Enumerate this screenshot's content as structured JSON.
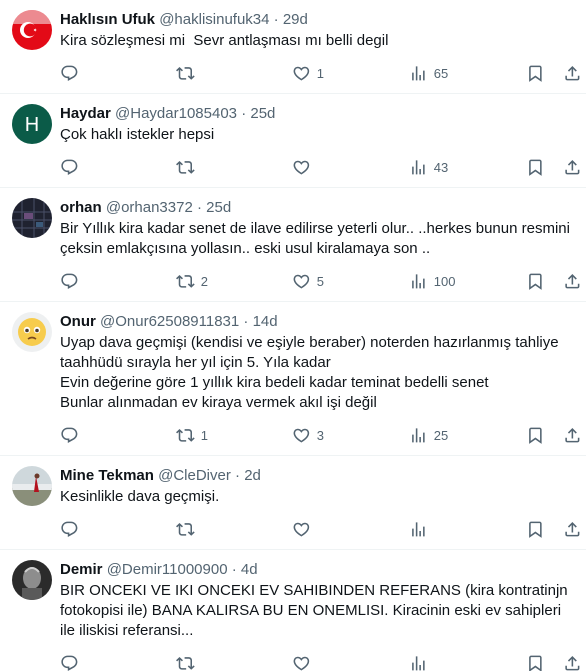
{
  "tweets": [
    {
      "name": "Haklısın Ufuk",
      "handle": "@haklisinufuk34",
      "time": "29d",
      "text": "Kira sözleşmesi mi  Sevr antlaşması mı belli degil",
      "replies": "",
      "retweets": "",
      "likes": "1",
      "views": "65",
      "avatar": "turkish-flag"
    },
    {
      "name": "Haydar",
      "handle": "@Haydar1085403",
      "time": "25d",
      "text": "Çok haklı istekler hepsi",
      "replies": "",
      "retweets": "",
      "likes": "",
      "views": "43",
      "avatar_letter": "H",
      "avatar_color": "#0b5b48"
    },
    {
      "name": "orhan",
      "handle": "@orhan3372",
      "time": "25d",
      "text": "Bir Yıllık kira kadar senet de ilave edilirse yeterli olur.. ..herkes bunun resmini çeksin emlakçısına yollasın.. eski usul kiralamaya son ..",
      "replies": "",
      "retweets": "2",
      "likes": "5",
      "views": "100",
      "avatar": "dark-pattern"
    },
    {
      "name": "Onur",
      "handle": "@Onur62508911831",
      "time": "14d",
      "text": "Uyap dava geçmişi (kendisi ve eşiyle beraber) noterden hazırlanmış tahliye taahhüdü sırayla her yıl için 5. Yıla kadar\nEvin değerine göre 1 yıllık kira bedeli kadar teminat bedelli senet\nBunlar alınmadan ev kiraya vermek akıl işi değil",
      "replies": "",
      "retweets": "1",
      "likes": "3",
      "views": "25",
      "avatar": "emoji-face"
    },
    {
      "name": "Mine Tekman",
      "handle": "@CleDiver",
      "time": "2d",
      "text": "Kesinlikle dava geçmişi.",
      "replies": "",
      "retweets": "",
      "likes": "",
      "views": "",
      "avatar": "landscape"
    },
    {
      "name": "Demir",
      "handle": "@Demir11000900",
      "time": "4d",
      "text": "BIR ONCEKI VE IKI ONCEKI EV SAHIBINDEN REFERANS (kira kontratinjn fotokopisi ile) BANA KALIRSA BU EN ONEMLISI. Kiracinin eski ev sahipleri ile iliskisi referansi...",
      "replies": "",
      "retweets": "",
      "likes": "",
      "views": "",
      "avatar": "bw-photo"
    }
  ],
  "separator": "·",
  "colors": {
    "text": "#0f1419",
    "secondary": "#536471",
    "border": "#eff3f4",
    "accent": "#1d9bf0"
  }
}
